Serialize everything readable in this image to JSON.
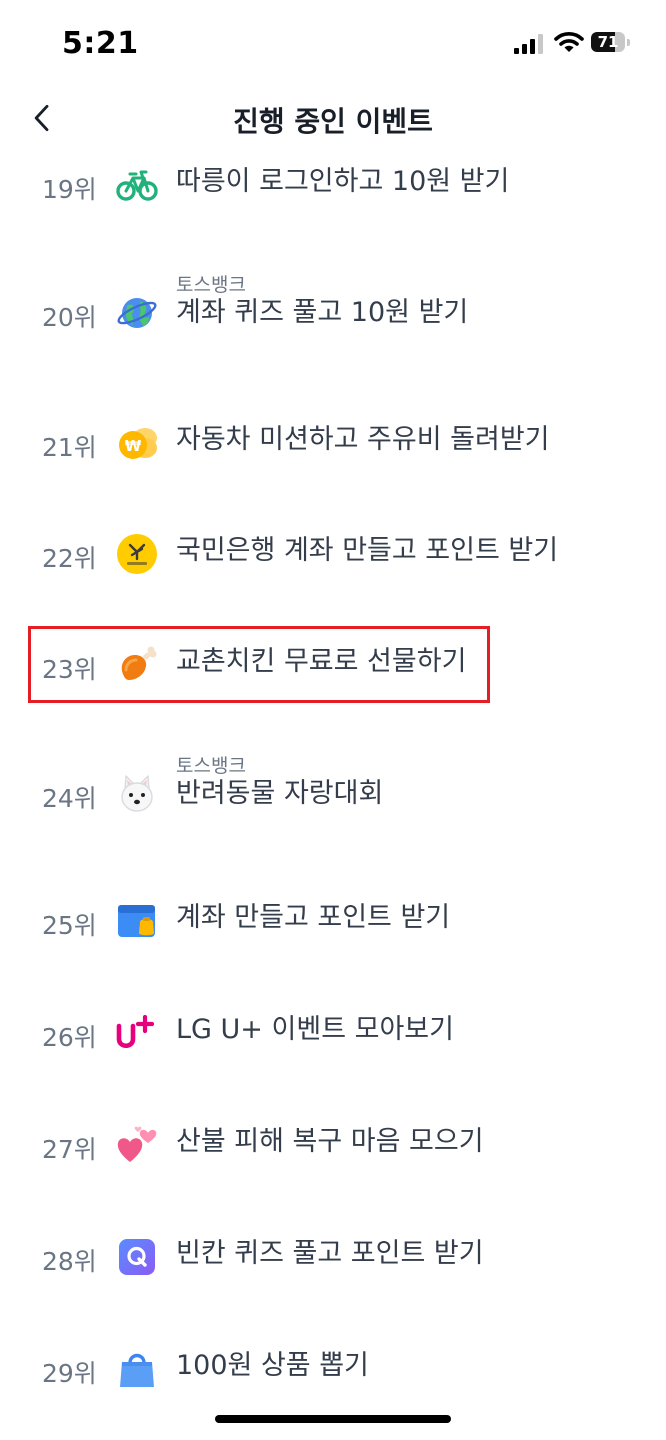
{
  "status_bar": {
    "time": "5:21",
    "battery": "71",
    "battery_level": 0.71
  },
  "header": {
    "title": "진행 중인 이벤트"
  },
  "highlight_rank": "23위",
  "events": [
    {
      "rank": "19위",
      "sub": "",
      "title": "따릉이 로그인하고 10원 받기",
      "icon": "bicycle-icon"
    },
    {
      "rank": "20위",
      "sub": "토스뱅크",
      "title": "계좌 퀴즈 풀고 10원 받기",
      "icon": "globe-icon"
    },
    {
      "rank": "21위",
      "sub": "",
      "title": "자동차 미션하고 주유비 돌려받기",
      "icon": "coin-icon"
    },
    {
      "rank": "22위",
      "sub": "",
      "title": "국민은행 계좌 만들고 포인트 받기",
      "icon": "kb-bank-logo-icon"
    },
    {
      "rank": "23위",
      "sub": "",
      "title": "교촌치킨 무료로 선물하기",
      "icon": "chicken-leg-icon"
    },
    {
      "rank": "24위",
      "sub": "토스뱅크",
      "title": "반려동물 자랑대회",
      "icon": "dog-face-icon"
    },
    {
      "rank": "25위",
      "sub": "",
      "title": "계좌 만들고 포인트 받기",
      "icon": "wallet-icon"
    },
    {
      "rank": "26위",
      "sub": "",
      "title": "LG U+ 이벤트 모아보기",
      "icon": "lg-uplus-logo-icon"
    },
    {
      "rank": "27위",
      "sub": "",
      "title": "산불 피해 복구 마음 모으기",
      "icon": "hearts-icon"
    },
    {
      "rank": "28위",
      "sub": "",
      "title": "빈칸 퀴즈 풀고 포인트 받기",
      "icon": "quiz-q-icon"
    },
    {
      "rank": "29위",
      "sub": "",
      "title": "100원 상품 뽑기",
      "icon": "shopping-bag-icon"
    }
  ]
}
